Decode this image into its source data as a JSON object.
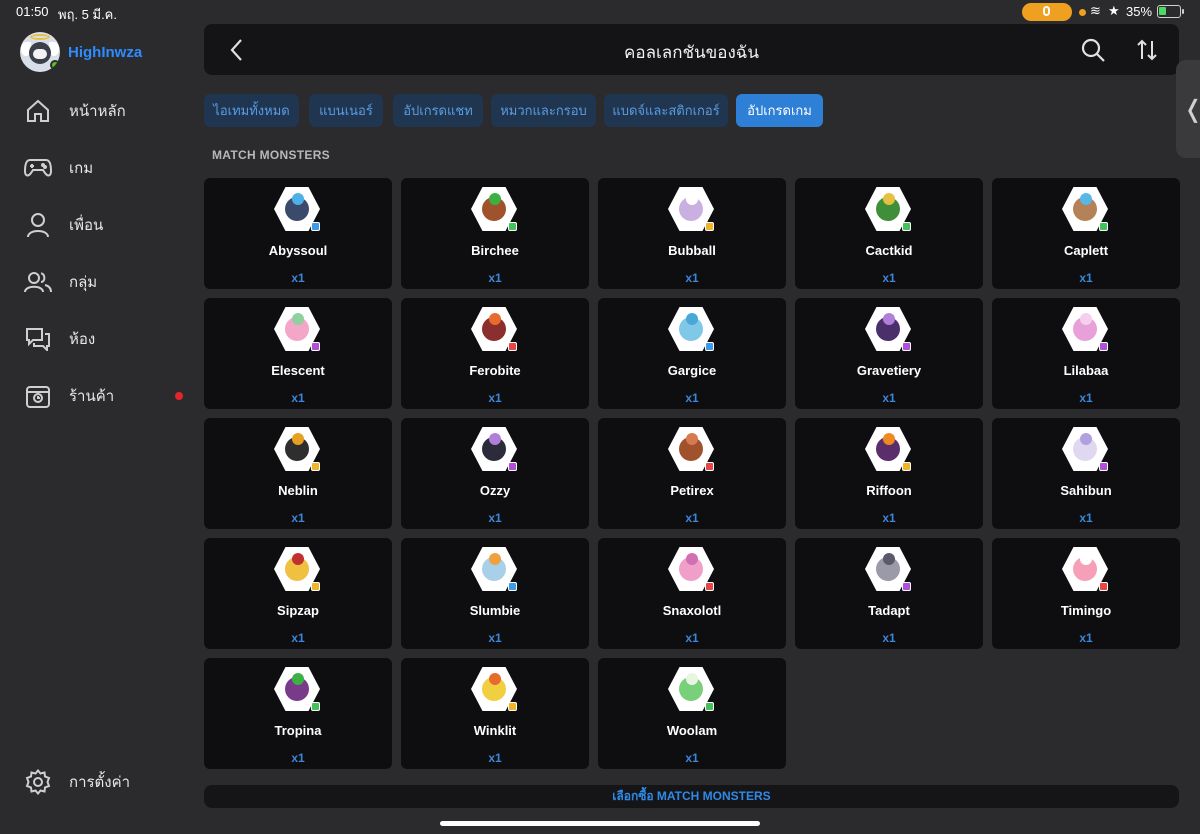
{
  "status": {
    "time": "01:50",
    "date": "พฤ. 5 มี.ค.",
    "battery": "35%",
    "battery_level": 0.35,
    "icons": [
      "microphone-icon",
      "wifi-icon",
      "star-icon",
      "battery-charging-icon"
    ]
  },
  "sidebar": {
    "username": "HighInwza",
    "items": [
      {
        "label": "หน้าหลัก",
        "icon": "home-icon"
      },
      {
        "label": "เกม",
        "icon": "gamepad-icon"
      },
      {
        "label": "เพื่อน",
        "icon": "user-icon"
      },
      {
        "label": "กลุ่ม",
        "icon": "group-icon"
      },
      {
        "label": "ห้อง",
        "icon": "chat-icon"
      },
      {
        "label": "ร้านค้า",
        "icon": "shop-icon",
        "has_notification": true
      }
    ],
    "settings_label": "การตั้งค่า"
  },
  "header": {
    "title": "คอลเลกชันของฉัน",
    "icons": [
      "back-icon",
      "search-icon",
      "sort-icon"
    ]
  },
  "tabs": [
    {
      "label": "ไอเทมทั้งหมด",
      "active": false
    },
    {
      "label": "แบนเนอร์",
      "active": false
    },
    {
      "label": "อัปเกรดแชท",
      "active": false
    },
    {
      "label": "หมวกและกรอบ",
      "active": false
    },
    {
      "label": "แบดจ์และสติกเกอร์",
      "active": false
    },
    {
      "label": "อัปเกรดเกม",
      "active": true
    }
  ],
  "section_title": "MATCH MONSTERS",
  "monsters": [
    {
      "name": "Abyssoul",
      "qty": "x1",
      "color": "#3b4a6b",
      "accent": "#4fb0e8",
      "gem": "#3d9ae8"
    },
    {
      "name": "Birchee",
      "qty": "x1",
      "color": "#a0522d",
      "accent": "#3cb043",
      "gem": "#43c15a"
    },
    {
      "name": "Bubball",
      "qty": "x1",
      "color": "#c9b0e0",
      "accent": "#ffffff",
      "gem": "#f0b429"
    },
    {
      "name": "Cactkid",
      "qty": "x1",
      "color": "#3f8f3a",
      "accent": "#e8c040",
      "gem": "#43c15a"
    },
    {
      "name": "Caplett",
      "qty": "x1",
      "color": "#b58257",
      "accent": "#57b8e8",
      "gem": "#43c15a"
    },
    {
      "name": "Elescent",
      "qty": "x1",
      "color": "#f3a6c8",
      "accent": "#8fd0a0",
      "gem": "#b04fd8"
    },
    {
      "name": "Ferobite",
      "qty": "x1",
      "color": "#8b2e2e",
      "accent": "#e86b2e",
      "gem": "#e84545"
    },
    {
      "name": "Gargice",
      "qty": "x1",
      "color": "#7fc8e8",
      "accent": "#4aa8d8",
      "gem": "#3d9ae8"
    },
    {
      "name": "Gravetiery",
      "qty": "x1",
      "color": "#4a2f6b",
      "accent": "#b07fd8",
      "gem": "#b04fd8"
    },
    {
      "name": "Lilabaa",
      "qty": "x1",
      "color": "#e8a0d8",
      "accent": "#f5d0ee",
      "gem": "#b04fd8"
    },
    {
      "name": "Neblin",
      "qty": "x1",
      "color": "#2e2e2e",
      "accent": "#e8a020",
      "gem": "#f0b429"
    },
    {
      "name": "Ozzy",
      "qty": "x1",
      "color": "#2b2b3b",
      "accent": "#b07fd8",
      "gem": "#b04fd8"
    },
    {
      "name": "Petirex",
      "qty": "x1",
      "color": "#a0522d",
      "accent": "#d87a50",
      "gem": "#e84545"
    },
    {
      "name": "Riffoon",
      "qty": "x1",
      "color": "#5a2e6b",
      "accent": "#f08a20",
      "gem": "#f0b429"
    },
    {
      "name": "Sahibun",
      "qty": "x1",
      "color": "#e0d8f0",
      "accent": "#b0a0e0",
      "gem": "#b04fd8"
    },
    {
      "name": "Sipzap",
      "qty": "x1",
      "color": "#f0c040",
      "accent": "#c03030",
      "gem": "#f0b429"
    },
    {
      "name": "Slumbie",
      "qty": "x1",
      "color": "#a8d0e8",
      "accent": "#f0a040",
      "gem": "#3d9ae8"
    },
    {
      "name": "Snaxolotl",
      "qty": "x1",
      "color": "#f0a0c8",
      "accent": "#d070b0",
      "gem": "#e84545"
    },
    {
      "name": "Tadapt",
      "qty": "x1",
      "color": "#9a9aa8",
      "accent": "#5a5a6b",
      "gem": "#b04fd8"
    },
    {
      "name": "Timingo",
      "qty": "x1",
      "color": "#f5a0b8",
      "accent": "#ffffff",
      "gem": "#e84545"
    },
    {
      "name": "Tropina",
      "qty": "x1",
      "color": "#7a3a8a",
      "accent": "#3cb043",
      "gem": "#43c15a"
    },
    {
      "name": "Winklit",
      "qty": "x1",
      "color": "#f0d040",
      "accent": "#e86b2e",
      "gem": "#f0b429"
    },
    {
      "name": "Woolam",
      "qty": "x1",
      "color": "#7ad07a",
      "accent": "#e8f5e0",
      "gem": "#43c15a"
    }
  ],
  "buy_label": "เลือกซื้อ MATCH MONSTERS",
  "colors": {
    "accent": "#2e7fd6",
    "brand": "#2d8cff",
    "notification": "#e8242b"
  }
}
